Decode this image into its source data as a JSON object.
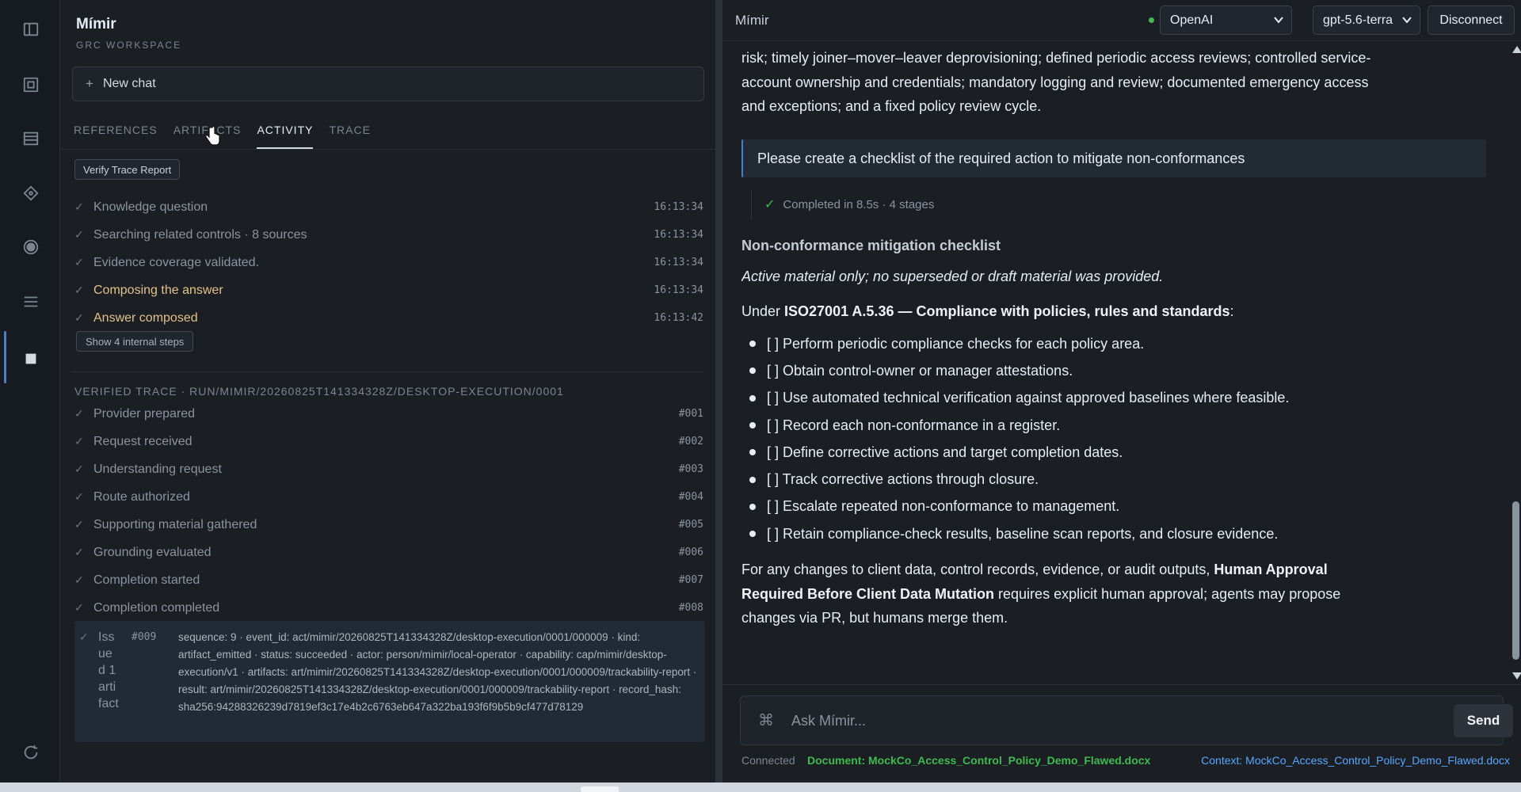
{
  "sidebar": {
    "brand": "Mímir",
    "subtitle": "GRC WORKSPACE",
    "new_chat": "New chat",
    "tabs": [
      {
        "label": "REFERENCES"
      },
      {
        "label": "ARTIFACTS"
      },
      {
        "label": "ACTIVITY"
      },
      {
        "label": "TRACE"
      }
    ],
    "verify_button": "Verify Trace Report",
    "activity": [
      {
        "label": "Knowledge question",
        "time": "16:13:34"
      },
      {
        "label": "Searching related controls · 8 sources",
        "time": "16:13:34"
      },
      {
        "label": "Evidence coverage validated.",
        "time": "16:13:34"
      },
      {
        "label": "Composing the answer",
        "time": "16:13:34"
      },
      {
        "label": "Answer composed",
        "time": "16:13:42"
      }
    ],
    "show_internal": "Show 4 internal steps",
    "verified_trace_heading": "VERIFIED TRACE · RUN/MIMIR/20260825T141334328Z/DESKTOP-EXECUTION/0001",
    "trace": [
      {
        "label": "Provider prepared",
        "num": "#001"
      },
      {
        "label": "Request received",
        "num": "#002"
      },
      {
        "label": "Understanding request",
        "num": "#003"
      },
      {
        "label": "Route authorized",
        "num": "#004"
      },
      {
        "label": "Supporting material gathered",
        "num": "#005"
      },
      {
        "label": "Grounding evaluated",
        "num": "#006"
      },
      {
        "label": "Completion started",
        "num": "#007"
      },
      {
        "label": "Completion completed",
        "num": "#008"
      }
    ],
    "trace_expanded": {
      "label": "Issued 1 artifact",
      "num": "#009",
      "detail": "sequence: 9 · event_id: act/mimir/20260825T141334328Z/desktop-execution/0001/000009 · kind: artifact_emitted · status: succeeded · actor: person/mimir/local-operator · capability: cap/mimir/desktop-execution/v1 · artifacts: art/mimir/20260825T141334328Z/desktop-execution/0001/000009/trackability-report · result: art/mimir/20260825T141334328Z/desktop-execution/0001/000009/trackability-report · record_hash: sha256:94288326239d7819ef3c17e4b2c6763eb647a322ba193f6f9b5b9cf477d78129"
    },
    "check": "✓"
  },
  "topbar": {
    "title": "Mímir",
    "provider": "OpenAI",
    "model": "gpt-5.6-terra",
    "disconnect": "Disconnect"
  },
  "chat": {
    "prev_text": "risk; timely joiner–mover–leaver deprovisioning; defined periodic access reviews; controlled service-account ownership and credentials; mandatory logging and review; documented emergency access and exceptions; and a fixed policy review cycle.",
    "user_message": "Please create a checklist of the required action to mitigate non-conformances",
    "status": "Completed in 8.5s · 4 stages",
    "heading": "Non-conformance mitigation checklist",
    "italic_note": "Active material only; no superseded or draft material was provided.",
    "under_prefix": "Under ",
    "under_bold": "ISO27001 A.5.36 — Compliance with policies, rules and standards",
    "under_suffix": ":",
    "checklist": [
      "[ ] Perform periodic compliance checks for each policy area.",
      "[ ] Obtain control-owner or manager attestations.",
      "[ ] Use automated technical verification against approved baselines where feasible.",
      "[ ] Record each non-conformance in a register.",
      "[ ] Define corrective actions and target completion dates.",
      "[ ] Track corrective actions through closure.",
      "[ ] Escalate repeated non-conformance to management.",
      "[ ] Retain compliance-check results, baseline scan reports, and closure evidence."
    ],
    "final_prefix": "For any changes to client data, control records, evidence, or audit outputs, ",
    "final_bold": "Human Approval Required Before Client Data Mutation",
    "final_suffix": " requires explicit human approval; agents may propose changes via PR, but humans merge them."
  },
  "composer": {
    "placeholder": "Ask Mímir...",
    "send": "Send",
    "cmd_glyph": "⌘"
  },
  "footer": {
    "connected": "Connected",
    "document": "Document: MockCo_Access_Control_Policy_Demo_Flawed.docx",
    "context": "Context: MockCo_Access_Control_Policy_Demo_Flawed.docx"
  },
  "colors": {
    "accent": "#4f7ec9",
    "success": "#3fb950",
    "highlight": "#e3c18b",
    "link": "#58a6ff"
  }
}
